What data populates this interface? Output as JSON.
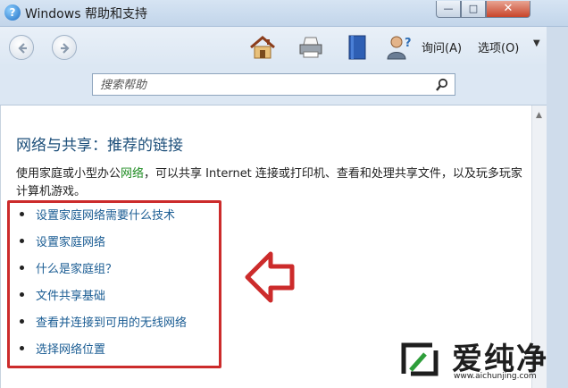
{
  "window": {
    "title": "Windows 帮助和支持",
    "minimize_label": "—",
    "maximize_label": "□",
    "close_label": "✕"
  },
  "toolbar": {
    "ask_label": "询问(A)",
    "options_label": "选项(O)",
    "options_arrow": "▼",
    "icons": [
      "back-icon",
      "forward-icon",
      "home-icon",
      "print-icon",
      "browse-help-icon",
      "ask-person-icon"
    ]
  },
  "search": {
    "placeholder": "搜索帮助",
    "value": ""
  },
  "content": {
    "heading": "网络与共享：推荐的链接",
    "description_prefix": "使用家庭或小型办公",
    "description_link": "网络",
    "description_suffix": "，可以共享 Internet 连接或打印机、查看和处理共享文件，以及玩多玩家计算机游戏。",
    "links": [
      "设置家庭网络需要什么技术",
      "设置家庭网络",
      "什么是家庭组？",
      "文件共享基础",
      "查看并连接到可用的无线网络",
      "选择网络位置"
    ]
  },
  "watermark": {
    "title": "爱纯净",
    "url": "www.aichunjing.com"
  },
  "colors": {
    "heading": "#1d4f7a",
    "link": "#1a5c93",
    "highlight_green": "#1f8c22",
    "annotation_red": "#cc2b2b"
  }
}
